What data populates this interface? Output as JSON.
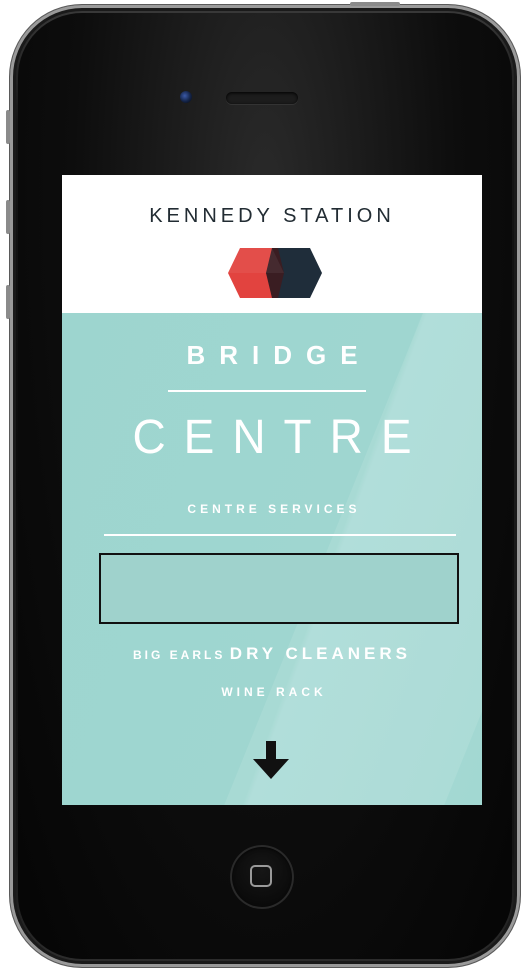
{
  "header": {
    "title": "KENNEDY STATION",
    "logo_icon": "hexagon-logo-icon"
  },
  "brand": {
    "line1": "BRIDGE",
    "line2": "CENTRE"
  },
  "services": {
    "heading": "CENTRE SERVICES",
    "items": [
      {
        "small": "BIG EARLS",
        "big": "DRY CLEANERS"
      },
      {
        "label": "WINE RACK"
      }
    ]
  },
  "scroll": {
    "icon": "arrow-down-icon"
  },
  "colors": {
    "accent_teal": "#9fd6d0",
    "logo_red": "#e2433f",
    "logo_dark": "#1f2d3a",
    "logo_overlap": "#3a1d22",
    "title_text": "#222c33"
  }
}
